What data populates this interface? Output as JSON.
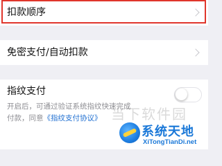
{
  "rows": {
    "payment_order": {
      "label": "扣款顺序"
    },
    "no_password_pay": {
      "label": "免密支付/自动扣款"
    },
    "fingerprint_pay": {
      "label": "指纹支付",
      "description_line1": "开启后，可通过验证系统指纹快速完成",
      "description_line2_prefix": "付款，同意",
      "agreement_link": "《指纹支付协议》",
      "toggle_enabled": false
    }
  },
  "watermark": {
    "text": "当下软件园",
    "logo_cn": "系统天地",
    "logo_en": "XiTongTianDi.net"
  },
  "colors": {
    "highlight_border": "#e0352b",
    "link": "#1f6fd1",
    "background": "#efeff4"
  }
}
